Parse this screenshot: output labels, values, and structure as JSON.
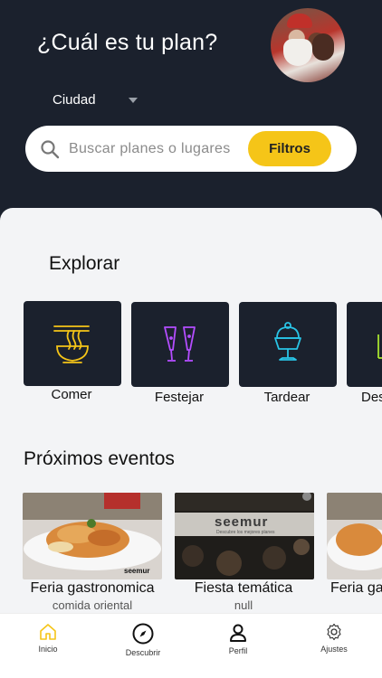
{
  "header": {
    "title": "¿Cuál es tu plan?",
    "city_label": "Ciudad"
  },
  "search": {
    "placeholder": "Buscar planes o lugares",
    "filter_label": "Filtros"
  },
  "explore": {
    "title": "Explorar",
    "categories": [
      {
        "label": "Comer",
        "icon": "noodle-bowl-icon",
        "color": "#f5c518"
      },
      {
        "label": "Festejar",
        "icon": "champagne-glasses-icon",
        "color": "#b44dff"
      },
      {
        "label": "Tardear",
        "icon": "ice-cream-sundae-icon",
        "color": "#29c4e6"
      },
      {
        "label": "Des",
        "icon": "partial-icon",
        "color": "#a6e22e"
      }
    ]
  },
  "events": {
    "title": "Próximos eventos",
    "items": [
      {
        "title": "Feria gastronomica",
        "subtitle": "comida oriental",
        "watermark": "seemur"
      },
      {
        "title": "Fiesta temática",
        "subtitle": "null",
        "watermark": "seemur",
        "banner_text": "Descubre los mejores planes"
      },
      {
        "title": "Feria ga",
        "subtitle": ""
      }
    ]
  },
  "tabbar": {
    "items": [
      {
        "label": "Inicio",
        "icon": "home-icon",
        "active": true
      },
      {
        "label": "Descubrir",
        "icon": "compass-icon",
        "active": false
      },
      {
        "label": "Perfil",
        "icon": "person-icon",
        "active": false
      },
      {
        "label": "Ajustes",
        "icon": "gear-icon",
        "active": false
      }
    ],
    "active_color": "#f5c518"
  }
}
